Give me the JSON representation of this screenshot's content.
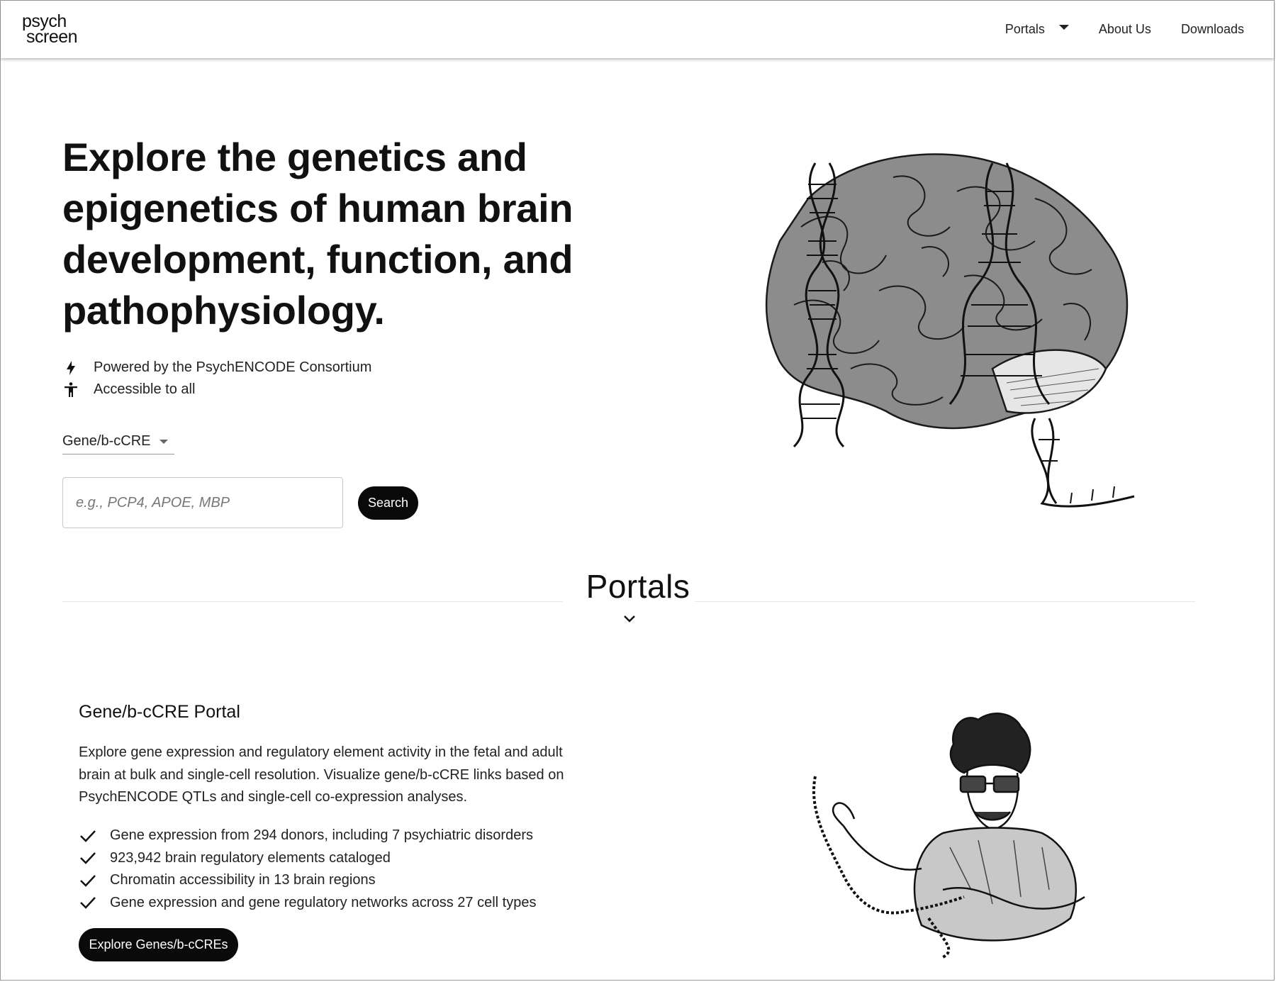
{
  "logo": {
    "line1": "psych",
    "line2": "screen"
  },
  "nav": {
    "portals": "Portals",
    "about": "About Us",
    "downloads": "Downloads"
  },
  "hero": {
    "headline": "Explore the genetics and epigenetics of human brain development, function, and pathophysiology.",
    "features": [
      {
        "icon": "bolt-icon",
        "text": "Powered by the PsychENCODE Consortium"
      },
      {
        "icon": "accessibility-icon",
        "text": "Accessible to all"
      }
    ],
    "search_type": "Gene/b-cCRE",
    "search_placeholder": "e.g., PCP4, APOE, MBP",
    "search_button": "Search"
  },
  "portals_section": {
    "title": "Portals"
  },
  "portal": {
    "title": "Gene/b-cCRE Portal",
    "description": "Explore gene expression and regulatory element activity in the fetal and adult brain at bulk and single-cell resolution. Visualize gene/b-cCRE links based on PsychENCODE QTLs and single-cell co-expression analyses.",
    "bullets": [
      "Gene expression from 294 donors, including 7 psychiatric disorders",
      "923,942 brain regulatory elements cataloged",
      "Chromatin accessibility in 13 brain regions",
      "Gene expression and gene regulatory networks across 27 cell types"
    ],
    "button": "Explore Genes/b-cCREs"
  },
  "colors": {
    "accent": "#0a0a0a",
    "background": "#ffffff",
    "text": "#111111"
  }
}
